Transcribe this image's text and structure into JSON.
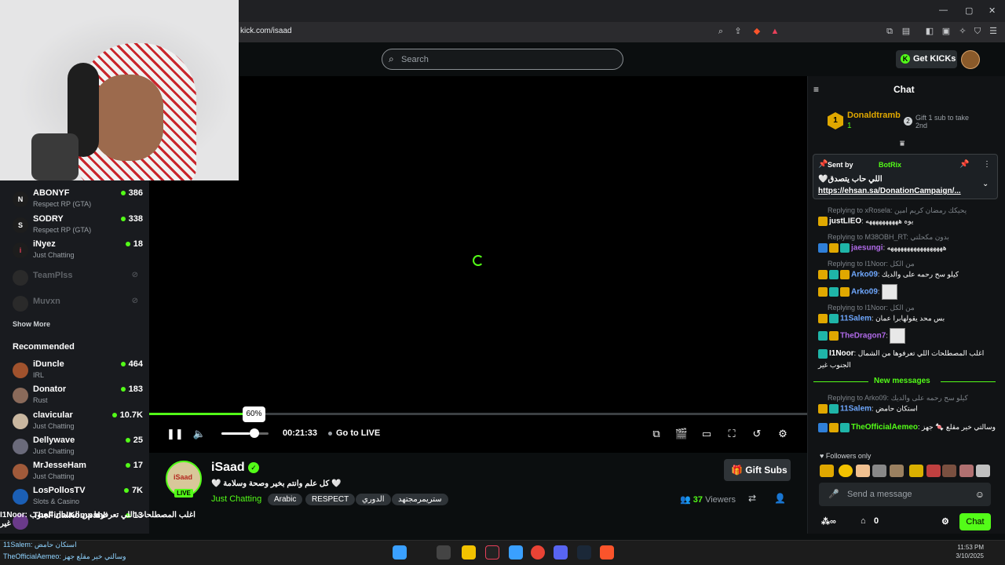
{
  "browser": {
    "url": "kick.com/isaad",
    "window_controls": [
      "—",
      "▢",
      "✕"
    ]
  },
  "topnav": {
    "search_placeholder": "Search",
    "get_kicks_label": "Get KICKs"
  },
  "sidebar": {
    "following": [
      {
        "avatar": "N",
        "name": "ABONYF",
        "category": "Respect RP (GTA)",
        "viewers": "386"
      },
      {
        "avatar": "S",
        "name": "SODRY",
        "category": "Respect RP (GTA)",
        "viewers": "338"
      },
      {
        "avatar": "i",
        "name": "iNyez",
        "category": "Just Chatting",
        "viewers": "18"
      }
    ],
    "offline": [
      {
        "name": "TeamPlss"
      },
      {
        "name": "Muvxn"
      }
    ],
    "show_more": "Show More",
    "recommended_title": "Recommended",
    "recommended": [
      {
        "name": "iDuncle",
        "category": "IRL",
        "viewers": "464"
      },
      {
        "name": "Donator",
        "category": "Rust",
        "viewers": "183"
      },
      {
        "name": "clavicular",
        "category": "Just Chatting",
        "viewers": "10.7K"
      },
      {
        "name": "Dellywave",
        "category": "Just Chatting",
        "viewers": "25"
      },
      {
        "name": "MrJesseHam",
        "category": "Just Chatting",
        "viewers": "17"
      },
      {
        "name": "LosPollosTV",
        "category": "Slots & Casino",
        "viewers": "7K"
      },
      {
        "name": "TheFinalKompahl",
        "category": "",
        "viewers": "13"
      }
    ]
  },
  "player": {
    "volume_popup": "60%",
    "volume_level": 0.6,
    "progress": 0.15,
    "time": "00:21:33",
    "go_live": "Go to LIVE"
  },
  "stream": {
    "avatar_text": "iSaad",
    "live_badge": "LIVE",
    "name": "iSaad",
    "title": "🤍 كل علم وانتم بخير وصحة وسلامة 🤍",
    "category": "Just Chatting",
    "tags": [
      "Arabic",
      "RESPECT",
      "الدوري",
      "ستريمرمجتهد"
    ],
    "gift_subs_label": "Gift Subs",
    "viewers_count": "37",
    "viewers_label": "Viewers"
  },
  "chat": {
    "title": "Chat",
    "top_gifter": {
      "rank": "1",
      "name": "Donaldtramb",
      "count": "1"
    },
    "second_rank": "2",
    "second_text": "Gift 1 sub to take 2nd",
    "pinned": {
      "sent_by": "Sent by",
      "bot": "BotRix",
      "message": "🤍اللي حاب يتصدق",
      "link": "https://ehsan.sa/DonationCampaign/..."
    },
    "messages": [
      {
        "reply": "Replying to xRosela: يحيكك رمضان كريم امين",
        "user": "justLIEO",
        "color": "#ffffff",
        "text": "يوه ههههههههههه"
      },
      {
        "reply": "Replying to M38OBH_RT: بدون مكحلتي",
        "user": "jaesungi",
        "color": "#b06ae8",
        "text": "هههههههههههههههههه"
      },
      {
        "reply": "Replying to I1Noor: من الكل",
        "user": "Arko09",
        "color": "#6fa8ff",
        "text": "كيلو سح رحمه على والديك"
      },
      {
        "reply": "",
        "user": "Arko09",
        "color": "#6fa8ff",
        "text": ""
      },
      {
        "reply": "Replying to I1Noor: من الكل",
        "user": "11Salem",
        "color": "#6fa8ff",
        "text": "بس محد يقولهابرا عمان"
      },
      {
        "reply": "",
        "user": "TheDragon7",
        "color": "#b06ae8",
        "text": ""
      },
      {
        "reply": "",
        "user": "I1Noor",
        "color": "#ffffff",
        "text": "اغلب المصطلحات اللي تعرفوها من الشمال الجنوب غير"
      }
    ],
    "new_messages": "New messages",
    "new_msgs": [
      {
        "reply": "Replying to Arko09: كيلو سح رحمه على والديك",
        "user": "11Salem",
        "color": "#6fa8ff",
        "text": "استكان حامض"
      },
      {
        "reply": "",
        "user": "TheOfficialAemeo",
        "color": "#53fc18",
        "text": "وسالتي خير مقلع 🍬 جهز"
      }
    ],
    "followers_only": "Followers only",
    "send_placeholder": "Send a message",
    "footer_count": "0",
    "chat_button": "Chat"
  },
  "overlay": {
    "line1": "I1Noor: اغلب المصطلحات اللي تعرفوها من الشمال الجنوب غير",
    "line2": "11Salem: استكان حامض",
    "line3": "TheOfficialAemeo: وسالتي خير مقلع جهز"
  },
  "taskbar": {
    "time": "11:53 PM",
    "date": "3/10/2025"
  },
  "colors": {
    "kick_green": "#53fc18",
    "bg": "#0b0e0f",
    "chat_bg": "#111315"
  }
}
